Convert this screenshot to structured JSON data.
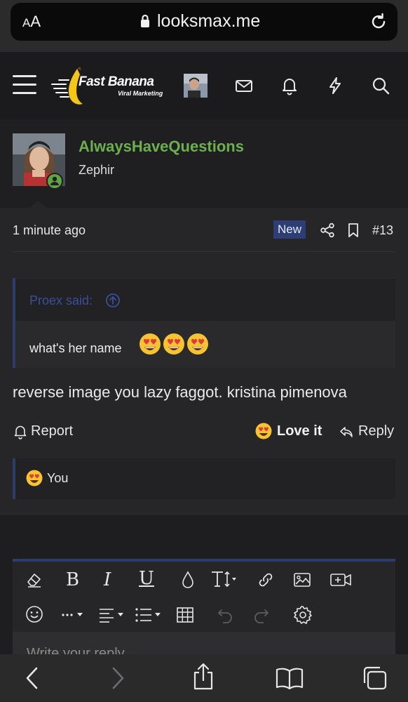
{
  "browser": {
    "text_size_label": "AA",
    "url": "looksmax.me",
    "icons": [
      "lock-icon",
      "reload-icon"
    ]
  },
  "header": {
    "logo_title": "Fast Banana",
    "logo_subtitle": "Viral Marketing",
    "icons": [
      "menu-icon",
      "avatar",
      "mail-icon",
      "bell-icon",
      "lightning-icon",
      "search-icon"
    ]
  },
  "post": {
    "username": "AlwaysHaveQuestions",
    "user_title": "Zephir",
    "time": "1 minute ago",
    "new_badge": "New",
    "post_number": "#13",
    "quote": {
      "author": "Proex said:",
      "text": "what's her name"
    },
    "text": "reverse image you lazy faggot. kristina pimenova",
    "actions": {
      "report": "Report",
      "love": "Love it",
      "reply": "Reply"
    },
    "reactions": {
      "you": "You"
    }
  },
  "editor": {
    "placeholder": "Write your reply...",
    "toolbar_row1": [
      "eraser-icon",
      "bold-icon",
      "italic-icon",
      "underline-icon",
      "color-icon",
      "text-size-icon",
      "link-icon",
      "image-icon",
      "video-icon"
    ],
    "toolbar_row2": [
      "emoji-icon",
      "more-icon",
      "align-icon",
      "list-icon",
      "table-icon",
      "undo-icon",
      "redo-icon",
      "settings-icon"
    ]
  },
  "colors": {
    "username": "#6bb04d",
    "accent": "#2d3c6c",
    "quote_author": "#3a4e9a",
    "banana": "#f5c518"
  }
}
